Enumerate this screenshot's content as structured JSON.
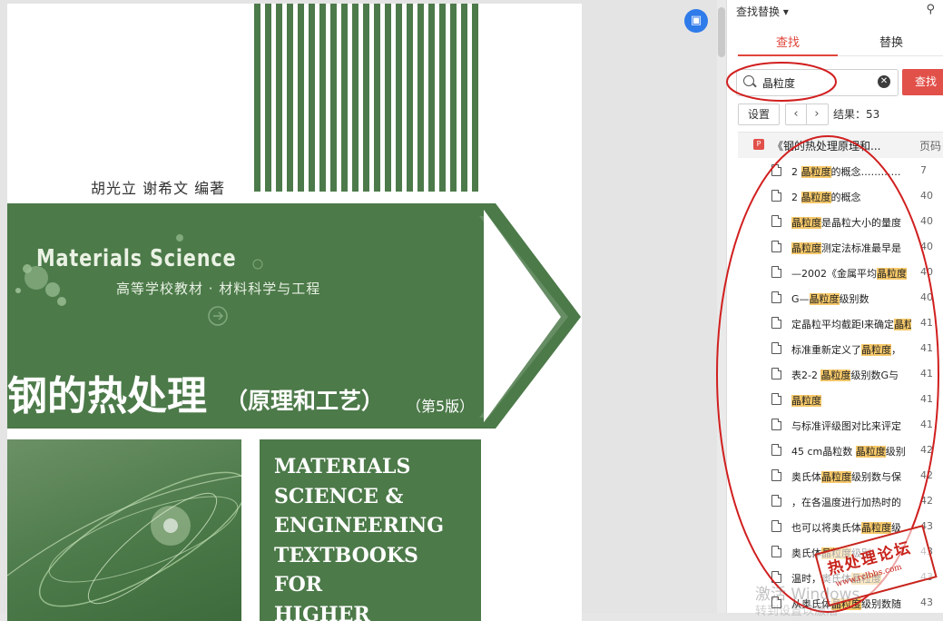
{
  "book": {
    "authors": "胡光立 谢希文 编著",
    "series_en": "Materials  Science",
    "series_cn": "高等学校教材 · 材料科学与工程",
    "title_main": "钢的热处理",
    "title_sub": "（原理和工艺）",
    "edition": "（第5版）",
    "en_title": "MATERIALS\nSCIENCE &\nENGINEERING\nTEXTBOOKS\nFOR\nHIGHER"
  },
  "panel": {
    "title": "查找替换 ▾",
    "tabs": [
      "查找",
      "替换"
    ],
    "search_value": "晶粒度",
    "find_button": "查找",
    "settings_button": "设置",
    "result_count": "结果：53",
    "file_name": "《钢的热处理原理和...",
    "page_column": "页码"
  },
  "results": [
    {
      "before": "2 ",
      "hit": "晶粒度",
      "after": "的概念…………",
      "page": "7"
    },
    {
      "before": "2 ",
      "hit": "晶粒度",
      "after": "的概念",
      "page": "40"
    },
    {
      "before": "",
      "hit": "晶粒度",
      "after": "是晶粒大小的量度",
      "page": "40"
    },
    {
      "before": "",
      "hit": "晶粒度",
      "after": "测定法标准最早是",
      "page": "40"
    },
    {
      "before": "—2002《金属平均",
      "hit": "晶粒度",
      "after": "",
      "page": "40"
    },
    {
      "before": "G—",
      "hit": "晶粒度",
      "after": "级别数",
      "page": "40"
    },
    {
      "before": "定晶粒平均截距l来确定",
      "hit": "晶粒度",
      "after": "",
      "page": "41"
    },
    {
      "before": "标准重新定义了",
      "hit": "晶粒度",
      "after": "，",
      "page": "41"
    },
    {
      "before": "表2-2 ",
      "hit": "晶粒度",
      "after": "级别数G与",
      "page": "41"
    },
    {
      "before": "",
      "hit": "晶粒度",
      "after": "",
      "page": "41"
    },
    {
      "before": "与标准评级图对比来评定",
      "hit": "",
      "after": "",
      "page": "41"
    },
    {
      "before": "45 cm晶粒数 ",
      "hit": "晶粒度",
      "after": "级别",
      "page": "42"
    },
    {
      "before": "奥氏体",
      "hit": "晶粒度",
      "after": "级别数与保",
      "page": "42"
    },
    {
      "before": "，在各温度进行加热时的",
      "hit": "",
      "after": "",
      "page": "42"
    },
    {
      "before": "也可以将奥氏体",
      "hit": "晶粒度",
      "after": "级",
      "page": "43"
    },
    {
      "before": "奥氏体",
      "hit": "晶粒度",
      "after": "级别",
      "page": "43"
    },
    {
      "before": "温时，奥氏体",
      "hit": "晶粒度",
      "after": "",
      "page": "43"
    },
    {
      "before": "从奥氏体",
      "hit": "晶粒度",
      "after": "级别数随",
      "page": "43"
    }
  ],
  "stamp": {
    "text": "热处理论坛",
    "url": "www.rclbbs.com"
  },
  "watermark": {
    "line1": "激活 Windows",
    "line2": "转到设置以激活"
  },
  "colors": {
    "book_green": "#4c7a49",
    "accent_red": "#e2504a",
    "highlight": "#f6c869",
    "annotation_red": "#d11f1f"
  }
}
